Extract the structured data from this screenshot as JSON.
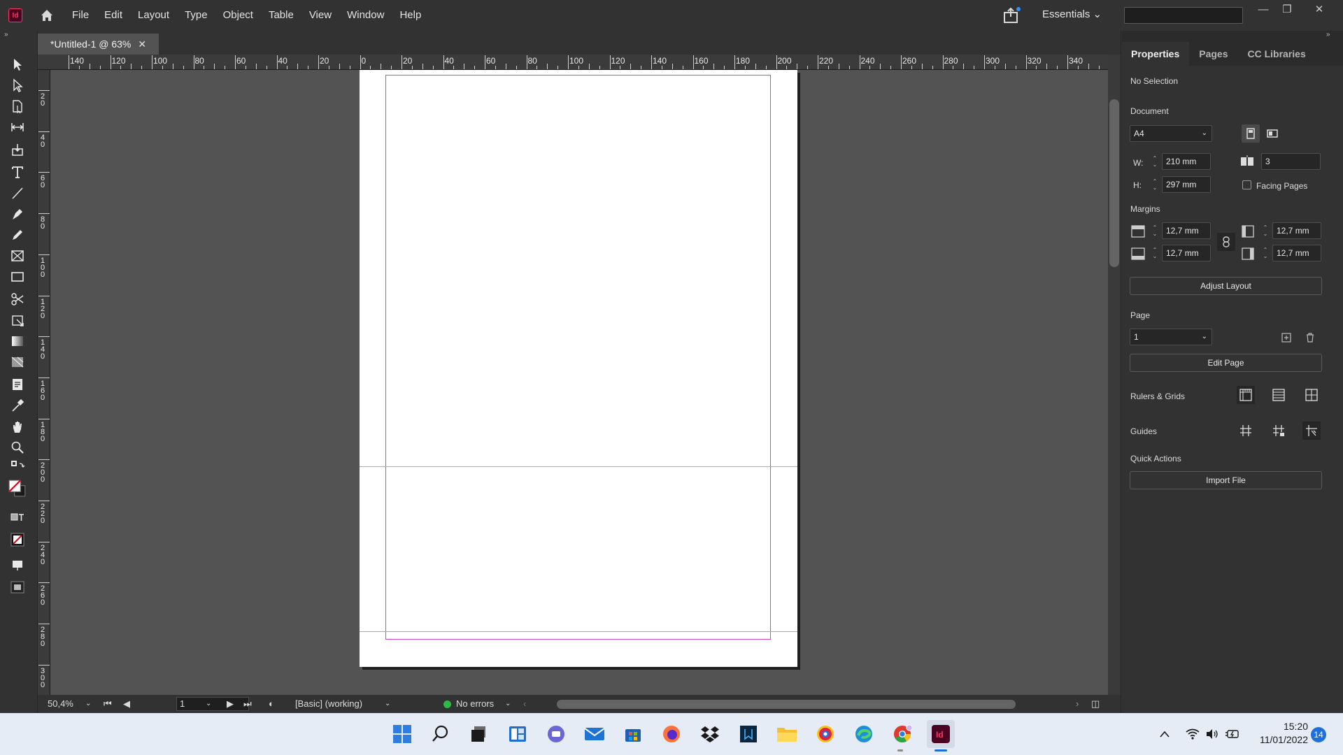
{
  "app": {
    "logo": "Id",
    "doc_tab": "*Untitled-1 @ 63%",
    "workspace": "Essentials"
  },
  "menu": [
    "File",
    "Edit",
    "Layout",
    "Type",
    "Object",
    "Table",
    "View",
    "Window",
    "Help"
  ],
  "rulers": {
    "horizontal": [
      "140",
      "120",
      "100",
      "80",
      "60",
      "40",
      "20",
      "0",
      "20",
      "40",
      "60",
      "80",
      "100",
      "120",
      "140",
      "160",
      "180",
      "200",
      "220",
      "240",
      "260",
      "280",
      "300",
      "320",
      "340"
    ],
    "vertical": [
      "20",
      "40",
      "60",
      "80",
      "100",
      "120",
      "140",
      "160",
      "180",
      "200",
      "220",
      "240",
      "260",
      "280",
      "300"
    ]
  },
  "status": {
    "zoom": "50,4%",
    "page": "1",
    "style": "[Basic] (working)",
    "preflight": "No errors"
  },
  "panel": {
    "tabs": [
      "Properties",
      "Pages",
      "CC Libraries"
    ],
    "selection": "No Selection",
    "document_label": "Document",
    "preset": "A4",
    "w_label": "W:",
    "width": "210 mm",
    "h_label": "H:",
    "height": "297 mm",
    "pages_count": "3",
    "facing_pages": "Facing Pages",
    "margins_label": "Margins",
    "margin_top": "12,7 mm",
    "margin_bottom": "12,7 mm",
    "margin_left": "12,7 mm",
    "margin_right": "12,7 mm",
    "adjust_layout": "Adjust Layout",
    "page_label": "Page",
    "page_value": "1",
    "edit_page": "Edit Page",
    "rulers_grids": "Rulers & Grids",
    "guides": "Guides",
    "quick_actions": "Quick Actions",
    "import_file": "Import File"
  },
  "taskbar": {
    "time": "15:20",
    "date": "11/01/2022",
    "notifications": "14"
  },
  "colors": {
    "accent_pink": "#ff3366",
    "margin": "#d043d0",
    "guide": "#3ad8dc",
    "preflight_ok": "#2db84a"
  }
}
